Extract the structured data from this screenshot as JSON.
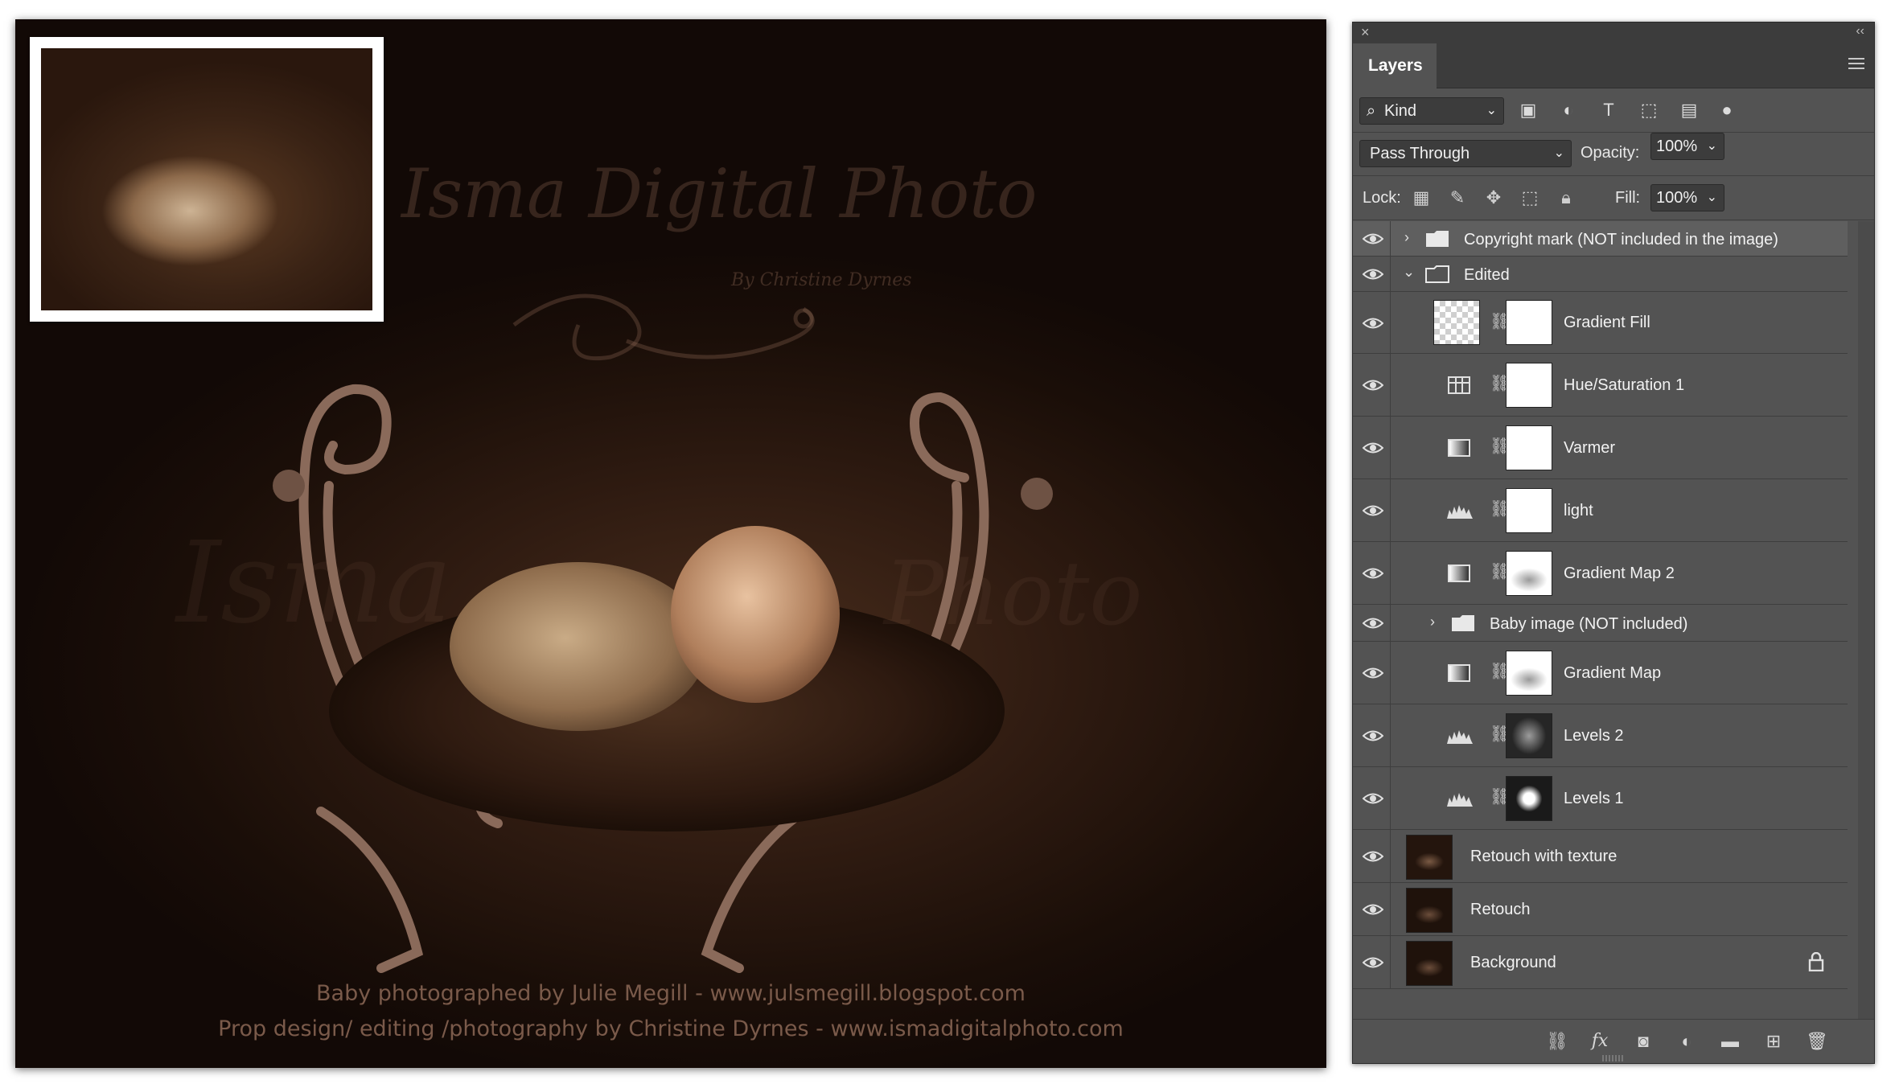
{
  "photo": {
    "watermark_title": "Isma Digital Photo",
    "watermark_sub": "By Christine Dyrnes",
    "watermark_repeat_left": "Isma",
    "watermark_repeat_right": "Photo",
    "credit_line_1": "Baby photographed by Julie Megill - www.julsmegill.blogspot.com",
    "credit_line_2": "Prop design/ editing /photography by Christine Dyrnes - www.ismadigitalphoto.com"
  },
  "panel": {
    "close_glyph": "×",
    "collapse_glyph": "‹‹",
    "tab_label": "Layers",
    "filter": {
      "kind_label": "Kind",
      "icons": [
        "image-filter-icon",
        "adjustment-filter-icon",
        "type-filter-icon",
        "shape-filter-icon",
        "smart-object-filter-icon",
        "filter-toggle-icon"
      ]
    },
    "blend_mode": "Pass Through",
    "opacity_label": "Opacity:",
    "opacity_value": "100%",
    "lock_label": "Lock:",
    "fill_label": "Fill:",
    "fill_value": "100%",
    "layers": [
      {
        "name": "Copyright mark (NOT included in the image)",
        "type": "group",
        "expanded": false,
        "selected": true
      },
      {
        "name": "Edited",
        "type": "group",
        "expanded": true
      },
      {
        "name": "Gradient Fill",
        "type": "fill"
      },
      {
        "name": "Hue/Saturation 1",
        "type": "huesat"
      },
      {
        "name": "Varmer",
        "type": "gradmap"
      },
      {
        "name": "light",
        "type": "levels"
      },
      {
        "name": "Gradient Map 2",
        "type": "gradmap"
      },
      {
        "name": "Baby image (NOT included)",
        "type": "subgroup",
        "expanded": false
      },
      {
        "name": "Gradient Map",
        "type": "gradmap"
      },
      {
        "name": "Levels 2",
        "type": "levels"
      },
      {
        "name": "Levels 1",
        "type": "levels"
      },
      {
        "name": "Retouch with texture",
        "type": "pixel"
      },
      {
        "name": "Retouch",
        "type": "pixel"
      },
      {
        "name": "Background",
        "type": "pixel",
        "locked": true
      }
    ],
    "bottom_icons": [
      "link-layers-icon",
      "fx-icon",
      "add-mask-icon",
      "new-adjustment-icon",
      "new-group-icon",
      "new-layer-icon",
      "delete-layer-icon"
    ]
  }
}
